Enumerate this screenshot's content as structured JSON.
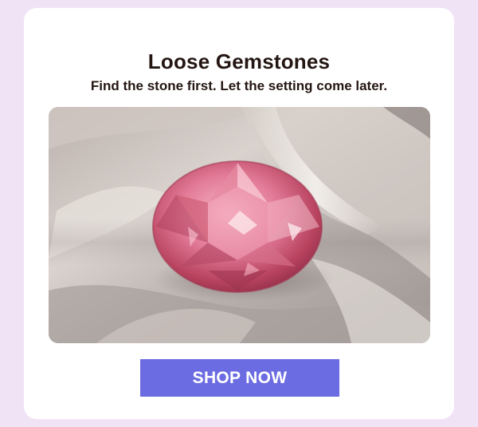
{
  "promo": {
    "title": "Loose Gemstones",
    "subtitle": "Find the stone first. Let the setting come later.",
    "cta_label": "SHOP NOW",
    "image_subject": "pink oval gemstone on satin fabric"
  },
  "colors": {
    "page_background": "#f1e3f6",
    "card_background": "#ffffff",
    "text": "#241612",
    "button": "#6c6ce2",
    "button_text": "#ffffff",
    "gem": "#e07a95"
  }
}
